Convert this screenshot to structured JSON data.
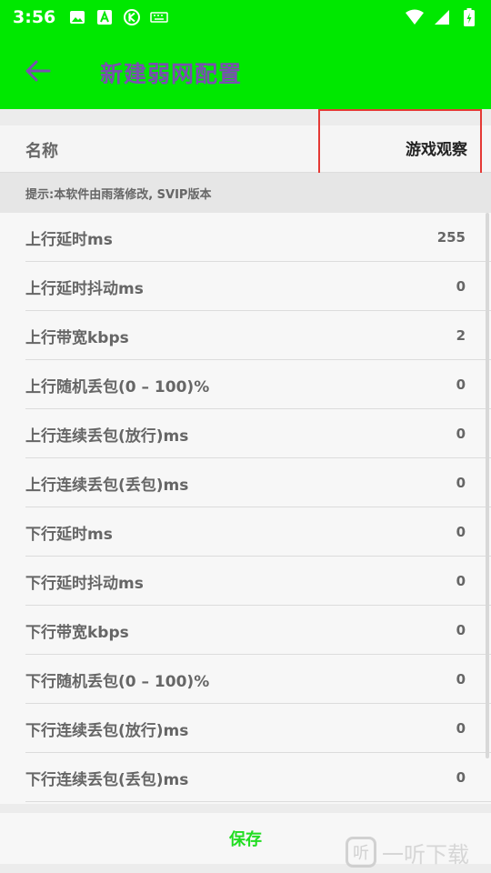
{
  "status_bar": {
    "time": "3:56",
    "icons_left": [
      "image-icon",
      "a-app-icon",
      "k-circle-icon",
      "keyboard-icon"
    ],
    "icons_right": [
      "wifi-icon",
      "signal-icon",
      "battery-icon"
    ]
  },
  "app_bar": {
    "title": "新建弱网配置",
    "back_icon": "arrow-left-icon"
  },
  "name_field": {
    "label": "名称",
    "value": "游戏观察"
  },
  "hint": "提示:本软件由雨落修改, SVIP版本",
  "rows": [
    {
      "label": "上行延时ms",
      "value": "255"
    },
    {
      "label": "上行延时抖动ms",
      "value": "0"
    },
    {
      "label": "上行带宽kbps",
      "value": "2"
    },
    {
      "label": "上行随机丢包(0 – 100)%",
      "value": "0"
    },
    {
      "label": "上行连续丢包(放行)ms",
      "value": "0"
    },
    {
      "label": "上行连续丢包(丢包)ms",
      "value": "0"
    },
    {
      "label": "下行延时ms",
      "value": "0"
    },
    {
      "label": "下行延时抖动ms",
      "value": "0"
    },
    {
      "label": "下行带宽kbps",
      "value": "0"
    },
    {
      "label": "下行随机丢包(0 – 100)%",
      "value": "0"
    },
    {
      "label": "下行连续丢包(放行)ms",
      "value": "0"
    },
    {
      "label": "下行连续丢包(丢包)ms",
      "value": "0"
    }
  ],
  "save_label": "保存",
  "watermark": {
    "logo_char": "听",
    "text": "一听下载"
  },
  "colors": {
    "header": "#00e800",
    "title": "#7a4fb0",
    "save": "#22dd22",
    "highlight": "#e53935"
  }
}
